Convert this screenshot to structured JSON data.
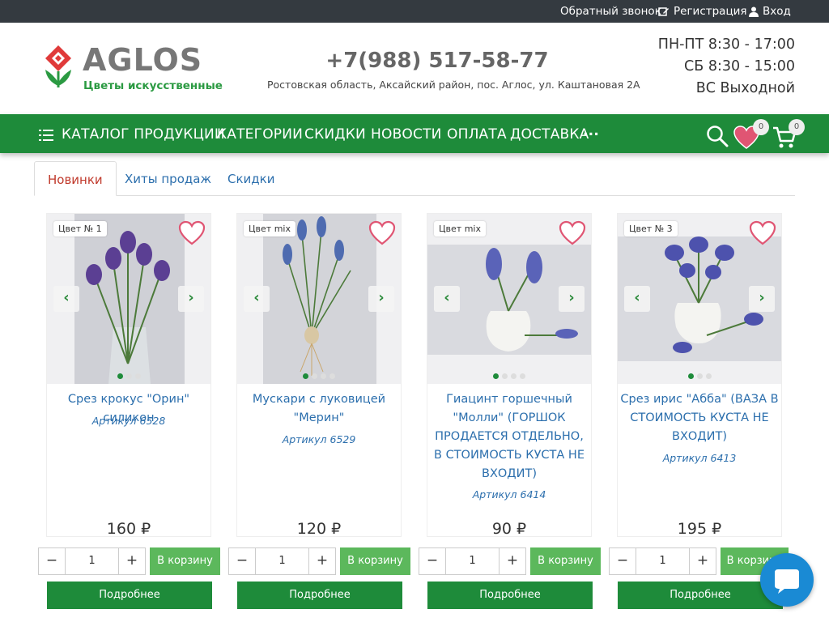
{
  "topbar": {
    "callback": "Обратный звонок",
    "register": "Регистрация",
    "login": "Вход"
  },
  "header": {
    "logo_word": "AGLOS",
    "logo_tagline": "Цветы искусственные",
    "phone": "+7(988) 517-58-77",
    "address": "Ростовская область, Аксайский район, пос. Аглос, ул. Каштановая 2А",
    "hours": [
      "ПН-ПТ 8:30 - 17:00",
      "СБ 8:30 - 15:00",
      "ВС Выходной"
    ]
  },
  "nav": {
    "items": [
      "КАТАЛОГ ПРОДУКЦИИ",
      "КАТЕГОРИИ",
      "СКИДКИ",
      "НОВОСТИ",
      "ОПЛАТА",
      "ДОСТАВКА",
      "..."
    ],
    "wishlist_count": "0",
    "cart_count": "0"
  },
  "tabs": [
    "Новинки",
    "Хиты продаж",
    "Скидки"
  ],
  "products": [
    {
      "tag": "Цвет № 1",
      "title": "Срез крокус \"Орин\" силикон",
      "article": "Артикул 6528",
      "price": "160 ₽",
      "qty": "1",
      "cart": "В корзину",
      "more": "Подробнее"
    },
    {
      "tag": "Цвет mix",
      "title": "Мускари с луковицей \"Мерин\"",
      "article": "Артикул 6529",
      "price": "120 ₽",
      "qty": "1",
      "cart": "В корзину",
      "more": "Подробнее"
    },
    {
      "tag": "Цвет mix",
      "title": "Гиацинт горшечный \"Молли\" (ГОРШОК ПРОДАЕТСЯ ОТДЕЛЬНО, В СТОИМОСТЬ КУСТА НЕ ВХОДИТ)",
      "article": "Артикул 6414",
      "price": "90 ₽",
      "qty": "1",
      "cart": "В корзину",
      "more": "Подробнее"
    },
    {
      "tag": "Цвет № 3",
      "title": "Срез ирис \"Абба\" (ВАЗА В СТОИМОСТЬ КУСТА НЕ ВХОДИТ)",
      "article": "Артикул 6413",
      "price": "195 ₽",
      "qty": "1",
      "cart": "В корзину",
      "more": "Подробнее"
    }
  ],
  "colors": {
    "green": "#1e8b3a",
    "light_green": "#5cb85c",
    "link": "#2c6fad",
    "topbar": "#343a40"
  }
}
